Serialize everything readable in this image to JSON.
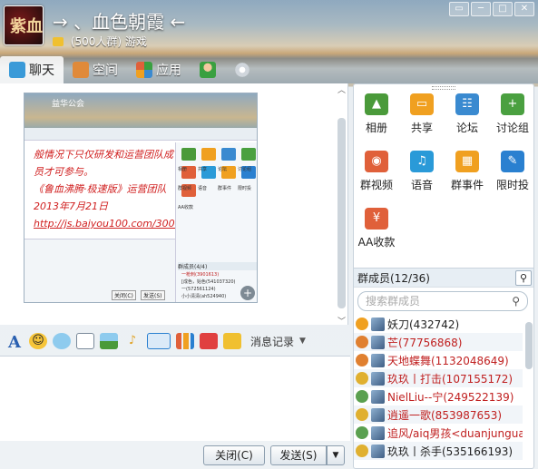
{
  "header": {
    "title": "→ 、血色朝霞 ←",
    "group_size": "(500人群)",
    "group_category": "游戏",
    "avatar_text": "紫血",
    "window_controls": [
      "▭",
      "─",
      "□",
      "✕"
    ]
  },
  "tabs": [
    {
      "label": "聊天",
      "active": true
    },
    {
      "label": "空间"
    },
    {
      "label": "应用"
    }
  ],
  "chat": {
    "screenshot": {
      "title": "益华公会",
      "lines": [
        "般情况下只仅研发和运营团队成员才可参与。",
        "《鲁血沸腾·极速版》运营团队",
        "2013年7月21日",
        "http://js.baiyou100.com/3001000.asp#"
      ],
      "apps": [
        "相册",
        "共享",
        "论坛",
        "讨论组",
        "群视频",
        "语音",
        "群事件",
        "限时投",
        "AA收款"
      ],
      "member_header": "群成员(4/4)",
      "members": [
        "一枪刺(3901613)",
        "[成色，始色(541037320)",
        "一(572561124)",
        "小小清清(ah524940)"
      ],
      "buttons": [
        "关闭(C)",
        "发送(S)"
      ]
    }
  },
  "toolbar": {
    "history_label": "消息记录"
  },
  "buttons": {
    "close": "关闭(C)",
    "send": "发送(S)"
  },
  "apps": [
    {
      "label": "相册",
      "icon": "photo-album-icon",
      "color": "#4a9a3a"
    },
    {
      "label": "共享",
      "icon": "folder-share-icon",
      "color": "#f0a020"
    },
    {
      "label": "论坛",
      "icon": "forum-icon",
      "color": "#3a8ad0"
    },
    {
      "label": "讨论组",
      "icon": "discussion-group-icon",
      "color": "#4aa040"
    },
    {
      "label": "群视频",
      "icon": "group-video-icon",
      "color": "#e0603a"
    },
    {
      "label": "语音",
      "icon": "voice-icon",
      "color": "#2a9ad8"
    },
    {
      "label": "群事件",
      "icon": "calendar-icon",
      "color": "#f0a020"
    },
    {
      "label": "限时投",
      "icon": "vote-icon",
      "color": "#2a80d0"
    },
    {
      "label": "AA收款",
      "icon": "payment-icon",
      "color": "#e0603a"
    }
  ],
  "members_section": {
    "header": "群成员(12/36)",
    "search_placeholder": "搜索群成员",
    "members": [
      {
        "name": "妖刀(432742)",
        "color": "#222",
        "badge": "#f0a020"
      },
      {
        "name": "芒(77756868)",
        "color": "#c02020",
        "badge": "#e08030"
      },
      {
        "name": "天地蝶舞(1132048649)",
        "color": "#c02020",
        "badge": "#e08030"
      },
      {
        "name": "玖玖丨打击(107155172)",
        "color": "#c02020",
        "badge": "#e0b030"
      },
      {
        "name": "NielLiu--宁(249522139)",
        "color": "#c02020",
        "badge": "#5aa050"
      },
      {
        "name": "逍遥一歌(853987653)",
        "color": "#c02020",
        "badge": "#e0b030"
      },
      {
        "name": "追风/aiq男孩<duanjunguan...",
        "color": "#c02020",
        "badge": "#5aa050"
      },
      {
        "name": "玖玖丨杀手(535166193)",
        "color": "#222",
        "badge": "#e0b030"
      }
    ]
  }
}
